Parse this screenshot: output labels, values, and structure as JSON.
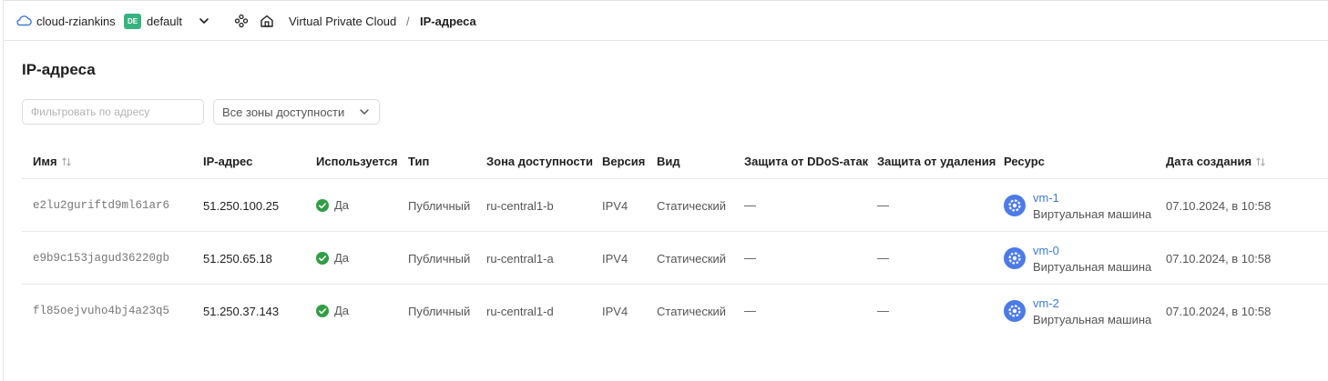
{
  "header": {
    "cloud_name": "cloud-rziankins",
    "folder_badge": "DE",
    "folder_name": "default",
    "breadcrumb": [
      "Virtual Private Cloud",
      "IP-адреса"
    ],
    "separator": "/"
  },
  "page": {
    "title": "IP-адреса"
  },
  "filters": {
    "address_placeholder": "Фильтровать по адресу",
    "zone_select_value": "Все зоны доступности"
  },
  "table": {
    "columns": [
      "Имя",
      "IP-адрес",
      "Используется",
      "Тип",
      "Зона доступности",
      "Версия",
      "Вид",
      "Защита от DDoS-атак",
      "Защита от удаления",
      "Ресурс",
      "Дата создания"
    ],
    "rows": [
      {
        "id": "e2lu2guriftd9ml61ar6",
        "ip": "51.250.100.25",
        "used": "Да",
        "type": "Публичный",
        "zone": "ru-central1-b",
        "version": "IPV4",
        "kind": "Статический",
        "ddos": "—",
        "deletion": "—",
        "resource_name": "vm-1",
        "resource_type": "Виртуальная машина",
        "created": "07.10.2024, в 10:58"
      },
      {
        "id": "e9b9c153jagud36220gb",
        "ip": "51.250.65.18",
        "used": "Да",
        "type": "Публичный",
        "zone": "ru-central1-a",
        "version": "IPV4",
        "kind": "Статический",
        "ddos": "—",
        "deletion": "—",
        "resource_name": "vm-0",
        "resource_type": "Виртуальная машина",
        "created": "07.10.2024, в 10:58"
      },
      {
        "id": "fl85oejvuho4bj4a23q5",
        "ip": "51.250.37.143",
        "used": "Да",
        "type": "Публичный",
        "zone": "ru-central1-d",
        "version": "IPV4",
        "kind": "Статический",
        "ddos": "—",
        "deletion": "—",
        "resource_name": "vm-2",
        "resource_type": "Виртуальная машина",
        "created": "07.10.2024, в 10:58"
      }
    ]
  },
  "colors": {
    "accent": "#3e7bd8",
    "success": "#2f9e44",
    "folder_badge": "#36b37e",
    "vm_icon": "#4c7be8"
  },
  "icons": {
    "cloud": "cloud-icon",
    "chevron": "chevron-down-icon",
    "services": "services-icon",
    "home": "home-icon",
    "sort": "sort-icon",
    "check": "check-circle-icon",
    "vm": "vm-gear-icon"
  }
}
